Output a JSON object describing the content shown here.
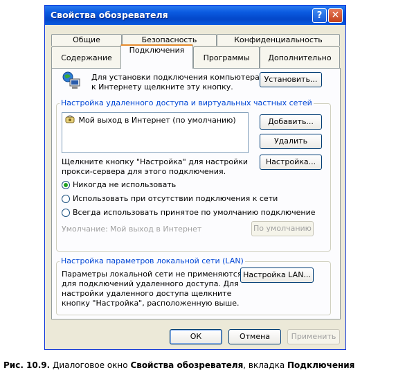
{
  "window": {
    "title": "Свойства обозревателя",
    "help_label": "?",
    "close_label": "✕",
    "accent_color": "#0a5ae0"
  },
  "tabs": {
    "row_back": [
      "Общие",
      "Безопасность",
      "Конфиденциальность"
    ],
    "row_front": [
      "Содержание",
      "Подключения",
      "Программы",
      "Дополнительно"
    ],
    "active": "Подключения"
  },
  "setup": {
    "text_line1": "Для установки подключения компьютера",
    "text_line2": "к Интернету щелкните эту кнопку.",
    "button": "Установить..."
  },
  "dialup": {
    "group_label": "Настройка удаленного доступа и виртуальных частных сетей",
    "list_items": [
      "Мой выход в Интернет (по умолчанию)"
    ],
    "add_button": "Добавить...",
    "remove_button": "Удалить",
    "settings_text_line1": "Щелкните кнопку \"Настройка\" для настройки",
    "settings_text_line2": "прокси-сервера для этого подключения.",
    "settings_button": "Настройка...",
    "radio_options": [
      {
        "label": "Никогда не использовать",
        "checked": true
      },
      {
        "label": "Использовать при отсутствии подключения к сети",
        "checked": false
      },
      {
        "label": "Всегда использовать принятое по умолчанию подключение",
        "checked": false
      }
    ],
    "default_label": "Умолчание:",
    "default_value": "Мой выход в Интернет",
    "default_button": "По умолчанию"
  },
  "lan": {
    "group_label": "Настройка параметров локальной сети (LAN)",
    "text_lines": [
      "Параметры локальной сети не применяются",
      "для подключений удаленного доступа. Для",
      "настройки удаленного доступа щелкните",
      "кнопку \"Настройка\", расположенную выше."
    ],
    "button": "Настройка LAN..."
  },
  "footer": {
    "ok": "ОК",
    "cancel": "Отмена",
    "apply": "Применить"
  },
  "caption": {
    "prefix": "Рис. 10.9.",
    "text1": "Диалоговое окно",
    "bold1": "Свойства обозревателя",
    "text2": ", вкладка",
    "bold2": "Подключения"
  }
}
